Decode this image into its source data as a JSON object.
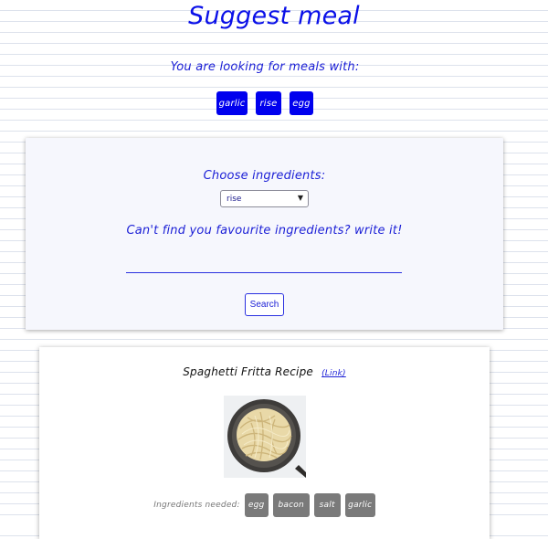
{
  "header": {
    "title": "Suggest meal",
    "looking_text": "You are looking for meals with:",
    "selected_ingredients": [
      "garlic",
      "rise",
      "egg"
    ]
  },
  "search": {
    "choose_label": "Choose ingredients:",
    "selected_option": "rise",
    "cantfind_label": "Can't find you favourite ingredients? write it!",
    "input_value": "",
    "button_label": "Search"
  },
  "result": {
    "title": "Spaghetti Fritta Recipe",
    "link_label": "(Link)",
    "ingredients_label": "Ingredients needed:",
    "ingredients": [
      "egg",
      "bacon",
      "salt",
      "garlic"
    ]
  },
  "colors": {
    "accent": "#0000ee",
    "text_blue": "#1b1fd6",
    "tag_grey": "#7a7a7a",
    "card_bg": "#f6f7fd"
  }
}
